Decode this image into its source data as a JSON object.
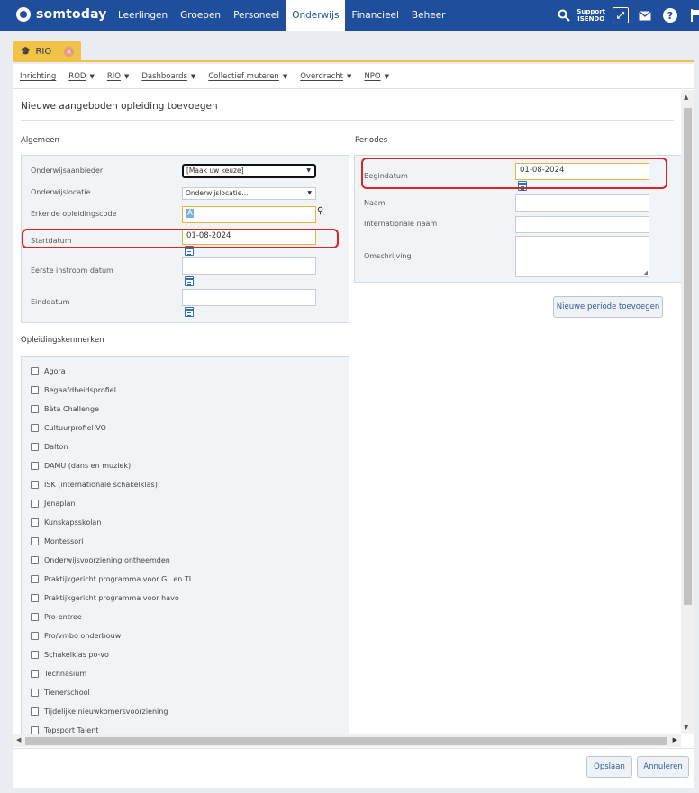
{
  "app": {
    "name": "somtoday"
  },
  "nav": {
    "items": [
      {
        "label": "Leerlingen"
      },
      {
        "label": "Groepen"
      },
      {
        "label": "Personeel"
      },
      {
        "label": "Onderwijs",
        "active": true
      },
      {
        "label": "Financieel"
      },
      {
        "label": "Beheer"
      }
    ],
    "support_line1": "Support",
    "support_line2": "ISENDO"
  },
  "tab": {
    "label": "RIO"
  },
  "subnav": {
    "items": [
      {
        "label": "Inrichting",
        "caret": false
      },
      {
        "label": "ROD",
        "caret": true
      },
      {
        "label": "RIO",
        "caret": true
      },
      {
        "label": "Dashboards",
        "caret": true
      },
      {
        "label": "Collectief muteren",
        "caret": true
      },
      {
        "label": "Overdracht",
        "caret": true
      },
      {
        "label": "NPO",
        "caret": true
      }
    ]
  },
  "page": {
    "title": "Nieuwe aangeboden opleiding toevoegen"
  },
  "algemeen": {
    "heading": "Algemeen",
    "onderwijsaanbieder_label": "Onderwijsaanbieder",
    "onderwijsaanbieder_value": "[Maak uw keuze]",
    "onderwijslocatie_label": "Onderwijslocatie",
    "onderwijslocatie_value": "Onderwijslocatie...",
    "erkende_label": "Erkende opleidingscode",
    "erkende_value": "A",
    "startdatum_label": "Startdatum",
    "startdatum_value": "01-08-2024",
    "eerste_instroom_label": "Eerste instroom datum",
    "eerste_instroom_value": "",
    "einddatum_label": "Einddatum",
    "einddatum_value": ""
  },
  "periodes": {
    "heading": "Periodes",
    "begindatum_label": "Begindatum",
    "begindatum_value": "01-08-2024",
    "naam_label": "Naam",
    "naam_value": "",
    "internationale_naam_label": "Internationale naam",
    "internationale_naam_value": "",
    "omschrijving_label": "Omschrijving",
    "omschrijving_value": "",
    "add_button": "Nieuwe periode toevoegen"
  },
  "kenmerken": {
    "heading": "Opleidingskenmerken",
    "items": [
      {
        "label": "Agora",
        "checked": false
      },
      {
        "label": "Begaafdheidsprofiel",
        "checked": false
      },
      {
        "label": "Bèta Challenge",
        "checked": false
      },
      {
        "label": "Cultuurprofiel VO",
        "checked": false
      },
      {
        "label": "Dalton",
        "checked": false
      },
      {
        "label": "DAMU (dans en muziek)",
        "checked": false
      },
      {
        "label": "ISK (internationale schakelklas)",
        "checked": false
      },
      {
        "label": "Jenaplan",
        "checked": false
      },
      {
        "label": "Kunskapsskolan",
        "checked": false
      },
      {
        "label": "Montessori",
        "checked": false
      },
      {
        "label": "Onderwijsvoorziening ontheemden",
        "checked": false
      },
      {
        "label": "Praktijkgericht programma voor GL en TL",
        "checked": false
      },
      {
        "label": "Praktijkgericht programma voor havo",
        "checked": false
      },
      {
        "label": "Pro-entree",
        "checked": false
      },
      {
        "label": "Pro/vmbo onderbouw",
        "checked": false
      },
      {
        "label": "Schakelklas po-vo",
        "checked": false
      },
      {
        "label": "Technasium",
        "checked": false
      },
      {
        "label": "Tienerschool",
        "checked": false
      },
      {
        "label": "Tijdelijke nieuwkomersvoorziening",
        "checked": false
      },
      {
        "label": "Topsport Talent",
        "checked": false
      }
    ]
  },
  "footer": {
    "save": "Opslaan",
    "cancel": "Annuleren"
  },
  "colors": {
    "brand": "#1f4e9c",
    "tab": "#f0c348",
    "highlight": "#e12222"
  }
}
